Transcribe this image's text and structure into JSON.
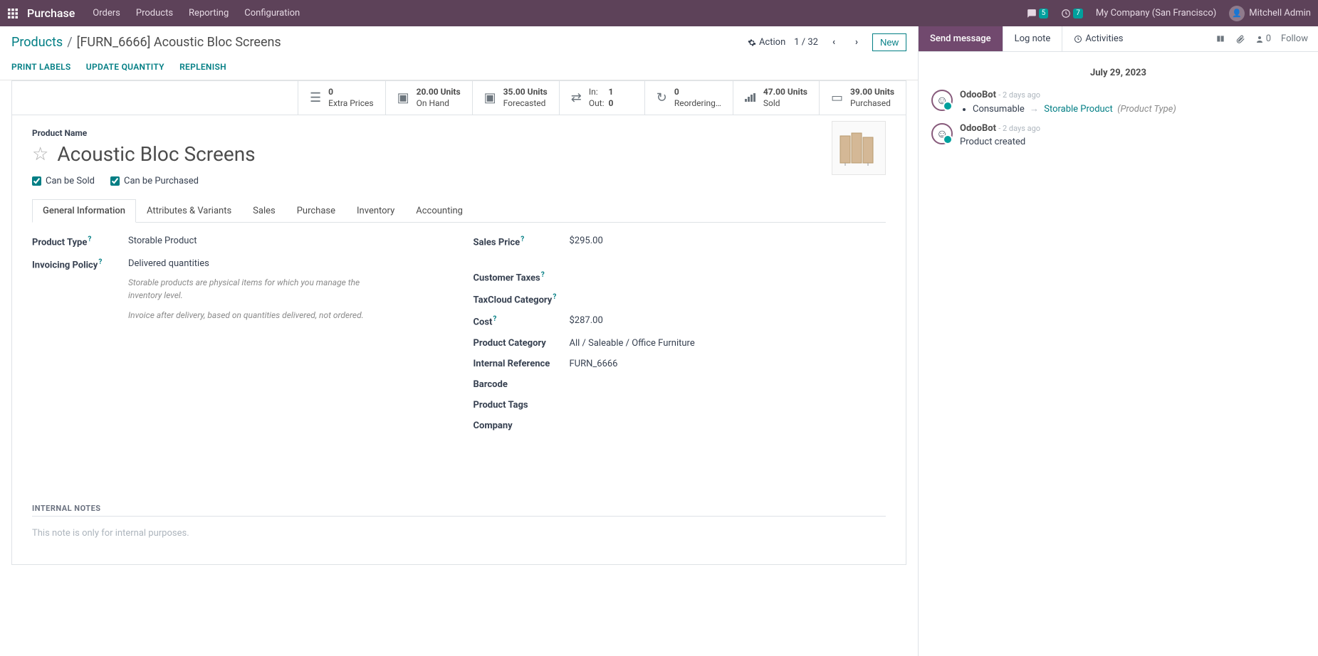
{
  "topbar": {
    "module": "Purchase",
    "nav": [
      "Orders",
      "Products",
      "Reporting",
      "Configuration"
    ],
    "chat_count": "5",
    "clock_count": "7",
    "company": "My Company (San Francisco)",
    "user": "Mitchell Admin"
  },
  "breadcrumb": {
    "root": "Products",
    "current": "[FURN_6666] Acoustic Bloc Screens",
    "action_label": "Action",
    "pager": "1 / 32",
    "new_btn": "New"
  },
  "action_buttons": {
    "print_labels": "PRINT LABELS",
    "update_quantity": "UPDATE QUANTITY",
    "replenish": "REPLENISH"
  },
  "stats": {
    "extra_prices": {
      "val": "0",
      "label": "Extra Prices"
    },
    "on_hand": {
      "val": "20.00 Units",
      "label": "On Hand"
    },
    "forecasted": {
      "val": "35.00 Units",
      "label": "Forecasted"
    },
    "inout": {
      "in_label": "In:",
      "in_val": "1",
      "out_label": "Out:",
      "out_val": "0"
    },
    "reordering": {
      "val": "0",
      "label": "Reordering…"
    },
    "sold": {
      "val": "47.00 Units",
      "label": "Sold"
    },
    "purchased": {
      "val": "39.00 Units",
      "label": "Purchased"
    }
  },
  "product": {
    "name_label": "Product Name",
    "title": "Acoustic Bloc Screens",
    "can_be_sold": "Can be Sold",
    "can_be_purchased": "Can be Purchased"
  },
  "tabs": [
    "General Information",
    "Attributes & Variants",
    "Sales",
    "Purchase",
    "Inventory",
    "Accounting"
  ],
  "fields": {
    "product_type": {
      "label": "Product Type",
      "value": "Storable Product"
    },
    "invoicing_policy": {
      "label": "Invoicing Policy",
      "value": "Delivered quantities"
    },
    "help1": "Storable products are physical items for which you manage the inventory level.",
    "help2": "Invoice after delivery, based on quantities delivered, not ordered.",
    "sales_price": {
      "label": "Sales Price",
      "value": "$295.00"
    },
    "customer_taxes": {
      "label": "Customer Taxes",
      "value": ""
    },
    "taxcloud": {
      "label": "TaxCloud Category",
      "value": ""
    },
    "cost": {
      "label": "Cost",
      "value": "$287.00"
    },
    "product_category": {
      "label": "Product Category",
      "value": "All / Saleable / Office Furniture"
    },
    "internal_reference": {
      "label": "Internal Reference",
      "value": "FURN_6666"
    },
    "barcode": {
      "label": "Barcode",
      "value": ""
    },
    "product_tags": {
      "label": "Product Tags",
      "value": ""
    },
    "company": {
      "label": "Company",
      "value": ""
    }
  },
  "internal_notes": {
    "label": "INTERNAL NOTES",
    "placeholder": "This note is only for internal purposes."
  },
  "chatter": {
    "send_message": "Send message",
    "log_note": "Log note",
    "activities": "Activities",
    "follower_count": "0",
    "follow": "Follow",
    "date_sep": "July 29, 2023",
    "msg1": {
      "author": "OdooBot",
      "time": "- 2 days ago",
      "from": "Consumable",
      "to": "Storable Product",
      "field": "(Product Type)"
    },
    "msg2": {
      "author": "OdooBot",
      "time": "- 2 days ago",
      "text": "Product created"
    }
  }
}
